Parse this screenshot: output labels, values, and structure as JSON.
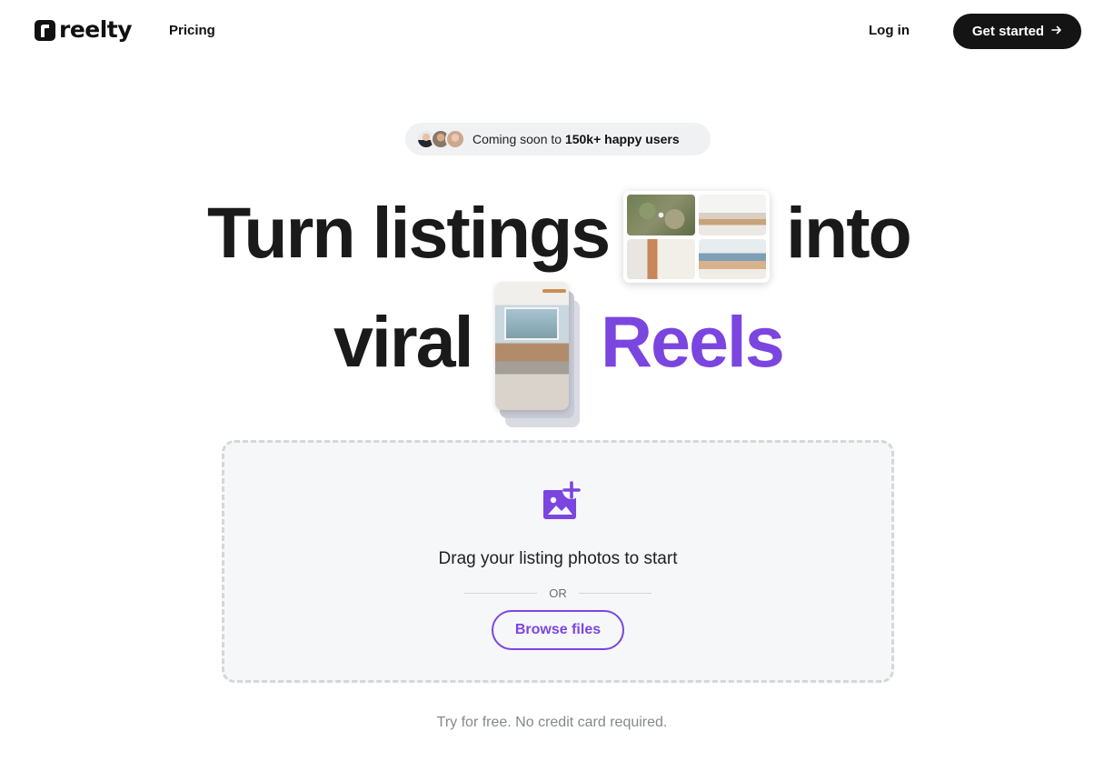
{
  "header": {
    "logo_text": "reelty",
    "nav_pricing": "Pricing",
    "nav_login": "Log in",
    "cta_label": "Get started",
    "cta_icon": "arrow-right-icon"
  },
  "badge": {
    "prefix": "Coming soon to ",
    "highlight": "150k+ happy users"
  },
  "hero": {
    "word1": "Turn listings",
    "word2": "into",
    "word3": "viral",
    "word4": "Reels",
    "accent_color": "#7b45e0"
  },
  "upload": {
    "icon": "add-photo-icon",
    "title": "Drag your listing photos to start",
    "or": "OR",
    "browse_label": "Browse files"
  },
  "footnote": "Try for free. No credit card required."
}
